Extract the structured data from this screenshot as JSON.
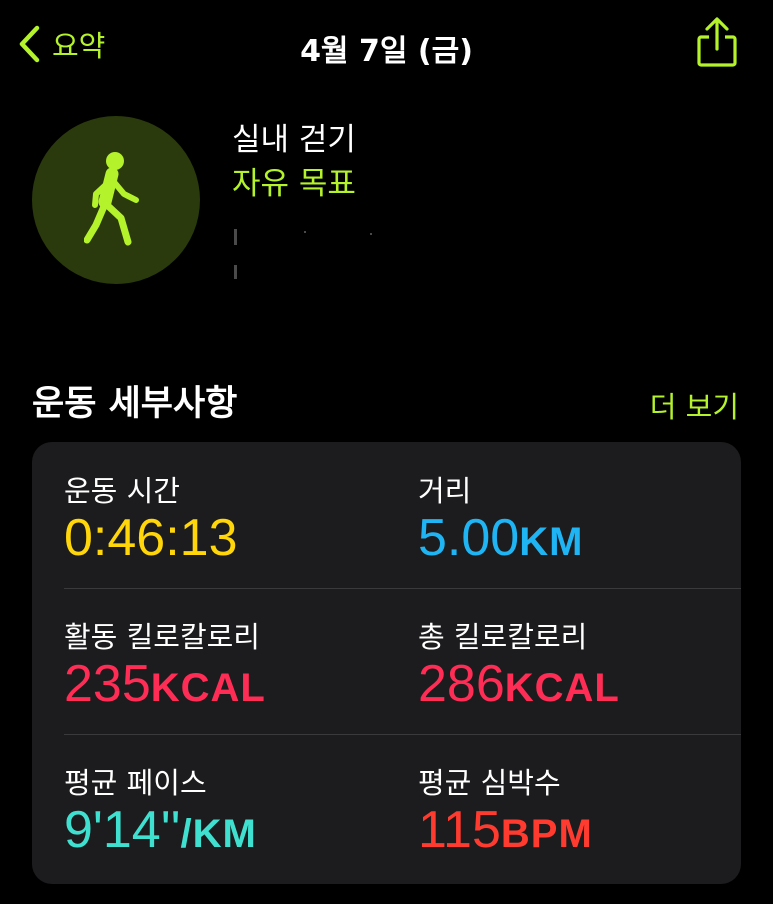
{
  "colors": {
    "accent": "#b4f22c",
    "time": "#ffd60a",
    "distance": "#1fb5f5",
    "calories": "#ff2d55",
    "pace": "#40e0d0",
    "heart_rate": "#ff3b30"
  },
  "nav": {
    "back_label": "요약",
    "title": "4월 7일 (금)",
    "back_icon": "chevron-left-icon",
    "share_icon": "share-icon"
  },
  "workout": {
    "icon": "walking-figure-icon",
    "name": "실내 걷기",
    "goal": "자유 목표"
  },
  "section": {
    "title": "운동 세부사항",
    "more_label": "더 보기"
  },
  "metrics": {
    "duration": {
      "label": "운동 시간",
      "value": "0:46:13",
      "unit": ""
    },
    "distance": {
      "label": "거리",
      "value": "5.00",
      "unit": "KM"
    },
    "active_calories": {
      "label": "활동 킬로칼로리",
      "value": "235",
      "unit": "KCAL"
    },
    "total_calories": {
      "label": "총 킬로칼로리",
      "value": "286",
      "unit": "KCAL"
    },
    "avg_pace": {
      "label": "평균 페이스",
      "value": "9'14''",
      "unit": "/KM"
    },
    "avg_heart_rate": {
      "label": "평균 심박수",
      "value": "115",
      "unit": "BPM"
    }
  }
}
